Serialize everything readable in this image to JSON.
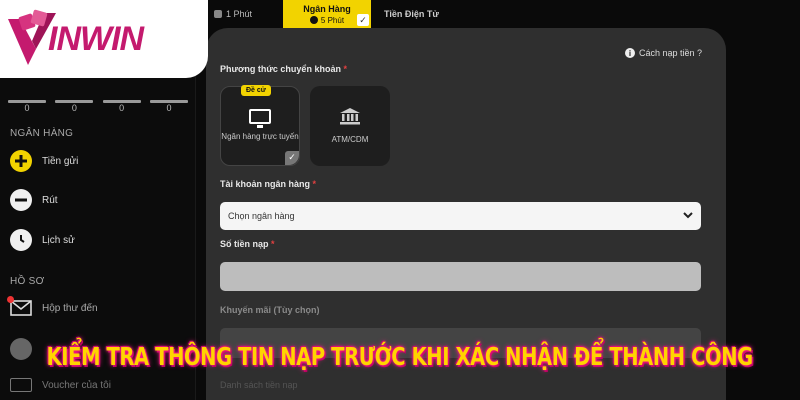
{
  "brand": {
    "logo_text": "INWIN",
    "logo_full": "VINWIN"
  },
  "sidebar": {
    "stats": [
      "0",
      "0",
      "0",
      "0"
    ],
    "section_bank": "NGÂN HÀNG",
    "items": [
      {
        "label": "Tiền gửi",
        "icon": "plus-icon"
      },
      {
        "label": "Rút",
        "icon": "minus-icon"
      },
      {
        "label": "Lịch sử",
        "icon": "clock-icon"
      }
    ],
    "section_profile": "HỒ SƠ",
    "profile_items": [
      {
        "label": "Hộp thư đến",
        "icon": "mail-icon"
      },
      {
        "label": "Voucher của tôi",
        "icon": "voucher-icon"
      }
    ]
  },
  "tabs": {
    "first": {
      "sub": "1 Phút"
    },
    "active": {
      "label": "Ngân Hàng",
      "sub": "5 Phút"
    },
    "third": {
      "label": "Tiền Điện Tử"
    }
  },
  "form": {
    "help": "Cách nạp tiền ?",
    "method_label": "Phương thức chuyển khoản",
    "methods": [
      {
        "label": "Ngân hàng trực tuyến",
        "badge": "Đề cử",
        "selected": true
      },
      {
        "label": "ATM/CDM",
        "selected": false
      }
    ],
    "account_label": "Tài khoản ngân hàng",
    "select_placeholder": "Chọn ngân hàng",
    "amount_label": "Số tiền nạp",
    "promo_label": "Khuyến mãi (Tùy chọn)",
    "bottom_label": "Danh sách tiền nạp"
  },
  "banner": {
    "text": "KIỂM TRA THÔNG TIN NẠP TRƯỚC KHI XÁC NHẬN ĐỂ THÀNH CÔNG"
  },
  "colors": {
    "accent": "#f2d300",
    "brand": "#c41a6e",
    "panel": "#2f2f2f",
    "banner_text": "#ffd400"
  }
}
